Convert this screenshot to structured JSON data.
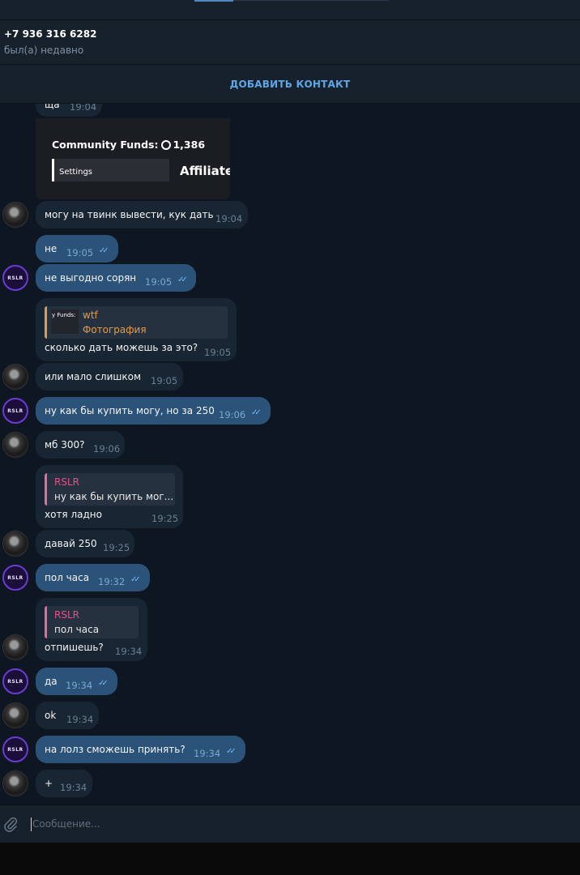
{
  "header": {
    "phone": "+7 936 316 6282",
    "status": "был(а) недавно",
    "add_contact": "ДОБАВИТЬ КОНТАКТ"
  },
  "messages": [
    {
      "text": "ща",
      "time": "19:04"
    },
    {
      "photo": {
        "line1": "Community Funds:",
        "amount": "1,386",
        "settings": "Settings",
        "affiliate": "Affiliate"
      }
    },
    {
      "text": "могу на твинк вывести, кук дать",
      "time": "19:04"
    },
    {
      "text": "не",
      "time": "19:05"
    },
    {
      "text": "не выгодно сорян",
      "time": "19:05"
    },
    {
      "reply_name": "wtf",
      "reply_text": "Фотография",
      "reply_thumb": "y Funds:",
      "text": "сколько дать можешь за это?",
      "time": "19:05"
    },
    {
      "text": "или мало слишком",
      "time": "19:05"
    },
    {
      "text": "ну как бы купить могу, но за 250",
      "time": "19:06"
    },
    {
      "text": "мб 300?",
      "time": "19:06"
    },
    {
      "reply_name": "RSLR",
      "reply_text": "ну как бы купить мог...",
      "text": "хотя ладно",
      "time": "19:25"
    },
    {
      "text": "давай 250",
      "time": "19:25"
    },
    {
      "text": "пол часа",
      "time": "19:32"
    },
    {
      "reply_name": "RSLR",
      "reply_text": "пол часа",
      "text": "отпишешь?",
      "time": "19:34"
    },
    {
      "text": "да",
      "time": "19:34"
    },
    {
      "text": "ok",
      "time": "19:34"
    },
    {
      "text": "на лолз сможешь принять?",
      "time": "19:34"
    },
    {
      "text": "+",
      "time": "19:34"
    }
  ],
  "avatar_rslr_label": "RSLR",
  "composer": {
    "placeholder": "Сообщение..."
  },
  "icons": {
    "attach": "paperclip-icon",
    "read": "double-check-icon"
  },
  "colors": {
    "outgoing": "#2b5278",
    "incoming": "#182533",
    "accent": "#5fa6e8",
    "reply_name": "#ee4c8b",
    "reply_photo": "#e79a45"
  }
}
